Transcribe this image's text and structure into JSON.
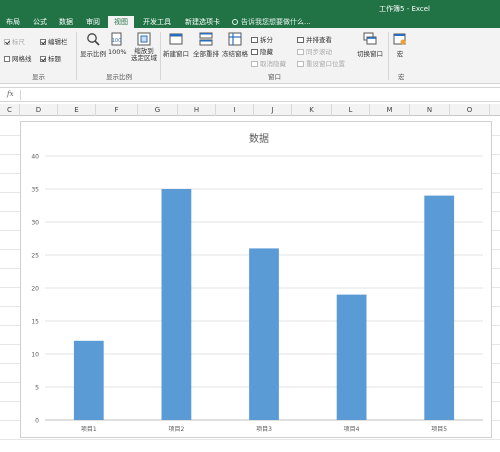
{
  "window": {
    "title": "工作簿5 - Excel"
  },
  "tabs": [
    {
      "label": "布局",
      "active": false
    },
    {
      "label": "公式",
      "active": false
    },
    {
      "label": "数据",
      "active": false
    },
    {
      "label": "审阅",
      "active": false
    },
    {
      "label": "视图",
      "active": true
    },
    {
      "label": "开发工具",
      "active": false
    },
    {
      "label": "新建选项卡",
      "active": false
    }
  ],
  "tell_me": {
    "placeholder": "告诉我您想要做什么..."
  },
  "ribbon": {
    "show_group": {
      "label": "显示",
      "ruler": {
        "label": "标尺",
        "checked": true,
        "enabled": false
      },
      "formula_bar": {
        "label": "编辑栏",
        "checked": true
      },
      "gridlines": {
        "label": "网格线",
        "checked": false
      },
      "headings": {
        "label": "标题",
        "checked": true
      }
    },
    "zoom_group": {
      "label": "显示比例",
      "zoom": "显示比例",
      "hundred": "100%",
      "zoom_to_selection_line1": "缩放到",
      "zoom_to_selection_line2": "选定区域"
    },
    "window_group": {
      "label": "窗口",
      "new_window": "新建窗口",
      "arrange_all": "全部重排",
      "freeze_panes": "冻结窗格",
      "split": "拆分",
      "hide": "隐藏",
      "unhide": "取消隐藏",
      "side_by_side": "并排查看",
      "sync_scroll": "同步滚动",
      "reset_position": "重设窗口位置",
      "switch_windows": "切换窗口"
    },
    "macro_group": {
      "label": "宏",
      "macros": "宏"
    }
  },
  "formula_bar": {
    "fx": "fx"
  },
  "columns": [
    "C",
    "D",
    "E",
    "F",
    "G",
    "H",
    "I",
    "J",
    "K",
    "L",
    "M",
    "N",
    "O"
  ],
  "colors": {
    "excel_green": "#217346",
    "bar": "#5b9bd5"
  },
  "chart_data": {
    "type": "bar",
    "title": "数据",
    "categories": [
      "项目1",
      "项目2",
      "项目3",
      "项目4",
      "项目5"
    ],
    "values": [
      12,
      35,
      26,
      19,
      34
    ],
    "ylim": [
      0,
      40
    ],
    "yticks": [
      0,
      5,
      10,
      15,
      20,
      25,
      30,
      35,
      40
    ],
    "xlabel": "",
    "ylabel": "",
    "grid": true,
    "legend": "none"
  }
}
